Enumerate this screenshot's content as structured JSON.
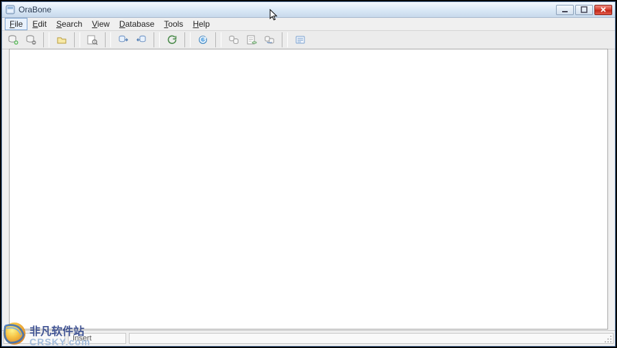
{
  "title": "OraBone",
  "menu": {
    "file": "File",
    "edit": "Edit",
    "search": "Search",
    "view": "View",
    "database": "Database",
    "tools": "Tools",
    "help": "Help"
  },
  "toolbar": {
    "icons": [
      "new-connection-icon",
      "disconnect-icon",
      "separator",
      "open-icon",
      "separator",
      "find-icon",
      "separator",
      "export-icon",
      "import-icon",
      "separator",
      "refresh-icon",
      "separator",
      "refresh-all-icon",
      "separator",
      "copy-struct-icon",
      "script-icon",
      "compare-icon",
      "separator",
      "sql-editor-icon"
    ]
  },
  "status": {
    "left": " ",
    "mode": "Insert"
  },
  "watermark": {
    "cn": "非凡软件站",
    "domain": "CRSKY.com"
  }
}
